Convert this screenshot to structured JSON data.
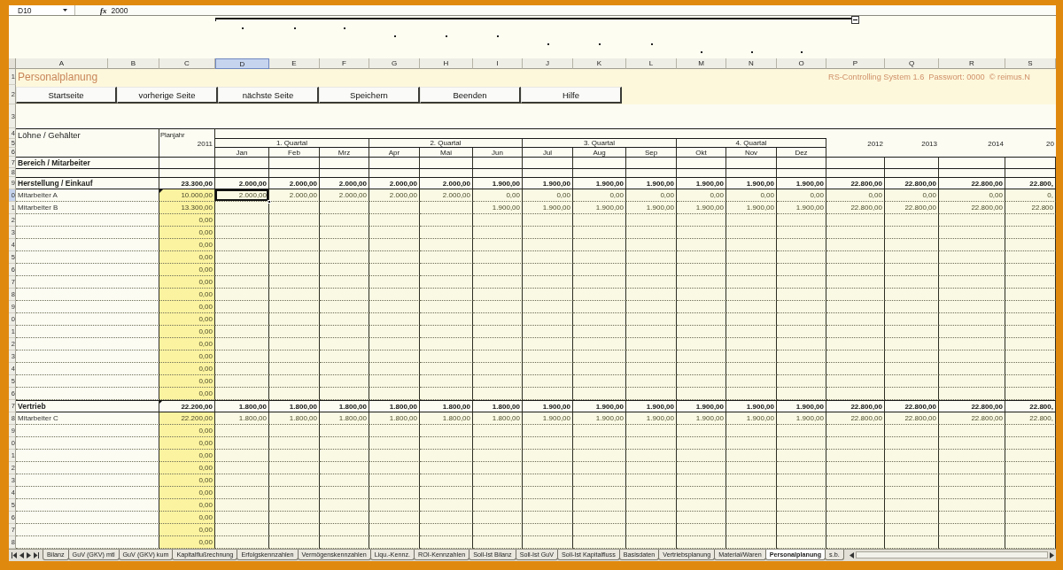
{
  "formula_bar": {
    "cell_reference": "D10",
    "function_label": "fx",
    "value": "2000"
  },
  "column_headers": [
    {
      "label": "A",
      "selected": false
    },
    {
      "label": "B",
      "selected": false
    },
    {
      "label": "C",
      "selected": false
    },
    {
      "label": "D",
      "selected": true
    },
    {
      "label": "E",
      "selected": false
    },
    {
      "label": "F",
      "selected": false
    },
    {
      "label": "G",
      "selected": false
    },
    {
      "label": "H",
      "selected": false
    },
    {
      "label": "I",
      "selected": false
    },
    {
      "label": "J",
      "selected": false
    },
    {
      "label": "K",
      "selected": false
    },
    {
      "label": "L",
      "selected": false
    },
    {
      "label": "M",
      "selected": false
    },
    {
      "label": "N",
      "selected": false
    },
    {
      "label": "O",
      "selected": false
    },
    {
      "label": "P",
      "selected": false
    },
    {
      "label": "Q",
      "selected": false
    },
    {
      "label": "R",
      "selected": false
    },
    {
      "label": "S",
      "selected": false
    }
  ],
  "top_row_headers": [
    {
      "row_number": "1",
      "selected": false
    },
    {
      "row_number": "2",
      "selected": false
    },
    {
      "row_number": "3",
      "selected": false
    },
    {
      "row_number": "4",
      "selected": false
    },
    {
      "row_number": "5",
      "selected": false
    },
    {
      "row_number": "6",
      "selected": false
    },
    {
      "row_number": "7",
      "selected": false
    },
    {
      "row_number": "8",
      "selected": false
    }
  ],
  "title": "Personalplanung",
  "info": "RS-Controlling System 1.6  Passwort: 0000  © reimus.N",
  "buttons": [
    "Startseite",
    "vorherige Seite",
    "nächste Seite",
    "Speichern",
    "Beenden",
    "Hilfe"
  ],
  "table": {
    "title": "Löhne / Gehälter",
    "plan_label": "Planjahr",
    "plan_year": "2011",
    "quarters": [
      {
        "label": "1. Quartal",
        "months": [
          "Jan",
          "Feb",
          "Mrz"
        ]
      },
      {
        "label": "2. Quartal",
        "months": [
          "Apr",
          "Mai",
          "Jun"
        ]
      },
      {
        "label": "3. Quartal",
        "months": [
          "Jul",
          "Aug",
          "Sep"
        ]
      },
      {
        "label": "4. Quartal",
        "months": [
          "Okt",
          "Nov",
          "Dez"
        ]
      }
    ],
    "years": [
      "2012",
      "2013",
      "2014",
      "20"
    ],
    "section_label": "Bereich / Mitarbeiter",
    "rows": [
      {
        "row_number": "9",
        "kind": "total",
        "label": "Herstellung / Einkauf",
        "selected": false,
        "note_marker": false,
        "cells": [
          "23.300,00",
          "2.000,00",
          "2.000,00",
          "2.000,00",
          "2.000,00",
          "2.000,00",
          "1.900,00",
          "1.900,00",
          "1.900,00",
          "1.900,00",
          "1.900,00",
          "1.900,00",
          "1.900,00",
          "22.800,00",
          "22.800,00",
          "22.800,00",
          "22.800,"
        ]
      },
      {
        "row_number": "0",
        "kind": "entry",
        "label": "Mitarbeiter A",
        "selected": true,
        "note_marker": true,
        "cells": [
          "10.000,00",
          "2.000,00",
          "2.000,00",
          "2.000,00",
          "2.000,00",
          "2.000,00",
          "0,00",
          "0,00",
          "0,00",
          "0,00",
          "0,00",
          "0,00",
          "0,00",
          "0,00",
          "0,00",
          "0,00",
          "0,"
        ]
      },
      {
        "row_number": "1",
        "kind": "entry",
        "label": "Mitarbeiter B",
        "selected": false,
        "note_marker": false,
        "cells": [
          "13.300,00",
          null,
          null,
          null,
          null,
          null,
          "1.900,00",
          "1.900,00",
          "1.900,00",
          "1.900,00",
          "1.900,00",
          "1.900,00",
          "1.900,00",
          "22.800,00",
          "22.800,00",
          "22.800,00",
          "22.800"
        ]
      },
      {
        "row_number": "2",
        "kind": "entry",
        "selected": false,
        "note_marker": false,
        "cells": [
          "0,00"
        ]
      },
      {
        "row_number": "3",
        "kind": "entry",
        "selected": false,
        "note_marker": false,
        "cells": [
          "0,00"
        ]
      },
      {
        "row_number": "4",
        "kind": "entry",
        "selected": false,
        "note_marker": false,
        "cells": [
          "0,00"
        ]
      },
      {
        "row_number": "5",
        "kind": "entry",
        "selected": false,
        "note_marker": false,
        "cells": [
          "0,00"
        ]
      },
      {
        "row_number": "6",
        "kind": "entry",
        "selected": false,
        "note_marker": false,
        "cells": [
          "0,00"
        ]
      },
      {
        "row_number": "7",
        "kind": "entry",
        "selected": false,
        "note_marker": false,
        "cells": [
          "0,00"
        ]
      },
      {
        "row_number": "8",
        "kind": "entry",
        "selected": false,
        "note_marker": false,
        "cells": [
          "0,00"
        ]
      },
      {
        "row_number": "9",
        "kind": "entry",
        "selected": false,
        "note_marker": false,
        "cells": [
          "0,00"
        ]
      },
      {
        "row_number": "0",
        "kind": "entry",
        "selected": false,
        "note_marker": false,
        "cells": [
          "0,00"
        ]
      },
      {
        "row_number": "1",
        "kind": "entry",
        "selected": false,
        "note_marker": false,
        "cells": [
          "0,00"
        ]
      },
      {
        "row_number": "2",
        "kind": "entry",
        "selected": false,
        "note_marker": false,
        "cells": [
          "0,00"
        ]
      },
      {
        "row_number": "3",
        "kind": "entry",
        "selected": false,
        "note_marker": false,
        "cells": [
          "0,00"
        ]
      },
      {
        "row_number": "4",
        "kind": "entry",
        "selected": false,
        "note_marker": false,
        "cells": [
          "0,00"
        ]
      },
      {
        "row_number": "5",
        "kind": "entry",
        "selected": false,
        "note_marker": false,
        "cells": [
          "0,00"
        ]
      },
      {
        "row_number": "6",
        "kind": "entry",
        "selected": false,
        "note_marker": false,
        "cells": [
          "0,00"
        ]
      },
      {
        "row_number": "7",
        "kind": "total",
        "label": "Vertrieb",
        "selected": false,
        "note_marker": true,
        "cells": [
          "22.200,00",
          "1.800,00",
          "1.800,00",
          "1.800,00",
          "1.800,00",
          "1.800,00",
          "1.800,00",
          "1.900,00",
          "1.900,00",
          "1.900,00",
          "1.900,00",
          "1.900,00",
          "1.900,00",
          "22.800,00",
          "22.800,00",
          "22.800,00",
          "22.800,"
        ]
      },
      {
        "row_number": "8",
        "kind": "entry",
        "label": "Mitarbeiter C",
        "selected": false,
        "note_marker": false,
        "cells": [
          "22.200,00",
          "1.800,00",
          "1.800,00",
          "1.800,00",
          "1.800,00",
          "1.800,00",
          "1.800,00",
          "1.900,00",
          "1.900,00",
          "1.900,00",
          "1.900,00",
          "1.900,00",
          "1.900,00",
          "22.800,00",
          "22.800,00",
          "22.800,00",
          "22.800,"
        ]
      },
      {
        "row_number": "9",
        "kind": "entry",
        "selected": false,
        "note_marker": false,
        "cells": [
          "0,00"
        ]
      },
      {
        "row_number": "0",
        "kind": "entry",
        "selected": false,
        "note_marker": false,
        "cells": [
          "0,00"
        ]
      },
      {
        "row_number": "1",
        "kind": "entry",
        "selected": false,
        "note_marker": false,
        "cells": [
          "0,00"
        ]
      },
      {
        "row_number": "2",
        "kind": "entry",
        "selected": false,
        "note_marker": false,
        "cells": [
          "0,00"
        ]
      },
      {
        "row_number": "3",
        "kind": "entry",
        "selected": false,
        "note_marker": false,
        "cells": [
          "0,00"
        ]
      },
      {
        "row_number": "4",
        "kind": "entry",
        "selected": false,
        "note_marker": false,
        "cells": [
          "0,00"
        ]
      },
      {
        "row_number": "5",
        "kind": "entry",
        "selected": false,
        "note_marker": false,
        "cells": [
          "0,00"
        ]
      },
      {
        "row_number": "6",
        "kind": "entry",
        "selected": false,
        "note_marker": false,
        "cells": [
          "0,00"
        ]
      },
      {
        "row_number": "7",
        "kind": "entry",
        "selected": false,
        "note_marker": false,
        "cells": [
          "0,00"
        ]
      },
      {
        "row_number": "8",
        "kind": "entry",
        "selected": false,
        "note_marker": false,
        "cells": [
          "0,00"
        ]
      }
    ]
  },
  "sheet_tabs": [
    {
      "label": "Bilanz",
      "selected": false
    },
    {
      "label": "GuV (GKV) mtl",
      "selected": false
    },
    {
      "label": "GuV (GKV) kum",
      "selected": false
    },
    {
      "label": "Kapitalflußrechnung",
      "selected": false
    },
    {
      "label": "Erfolgskennzahlen",
      "selected": false
    },
    {
      "label": "Vermögenskennzahlen",
      "selected": false
    },
    {
      "label": "Liqu.-Kennz.",
      "selected": false
    },
    {
      "label": "ROI-Kennzahlen",
      "selected": false
    },
    {
      "label": "Soll-Ist Bilanz",
      "selected": false
    },
    {
      "label": "Soll-Ist GuV",
      "selected": false
    },
    {
      "label": "Soll-Ist Kapitalfluss",
      "selected": false
    },
    {
      "label": "Basisdaten",
      "selected": false
    },
    {
      "label": "Vertriebsplanung",
      "selected": false
    },
    {
      "label": "Material/Waren",
      "selected": false
    },
    {
      "label": "Personalplanung",
      "selected": true
    },
    {
      "label": "s.b.",
      "selected": false
    }
  ]
}
